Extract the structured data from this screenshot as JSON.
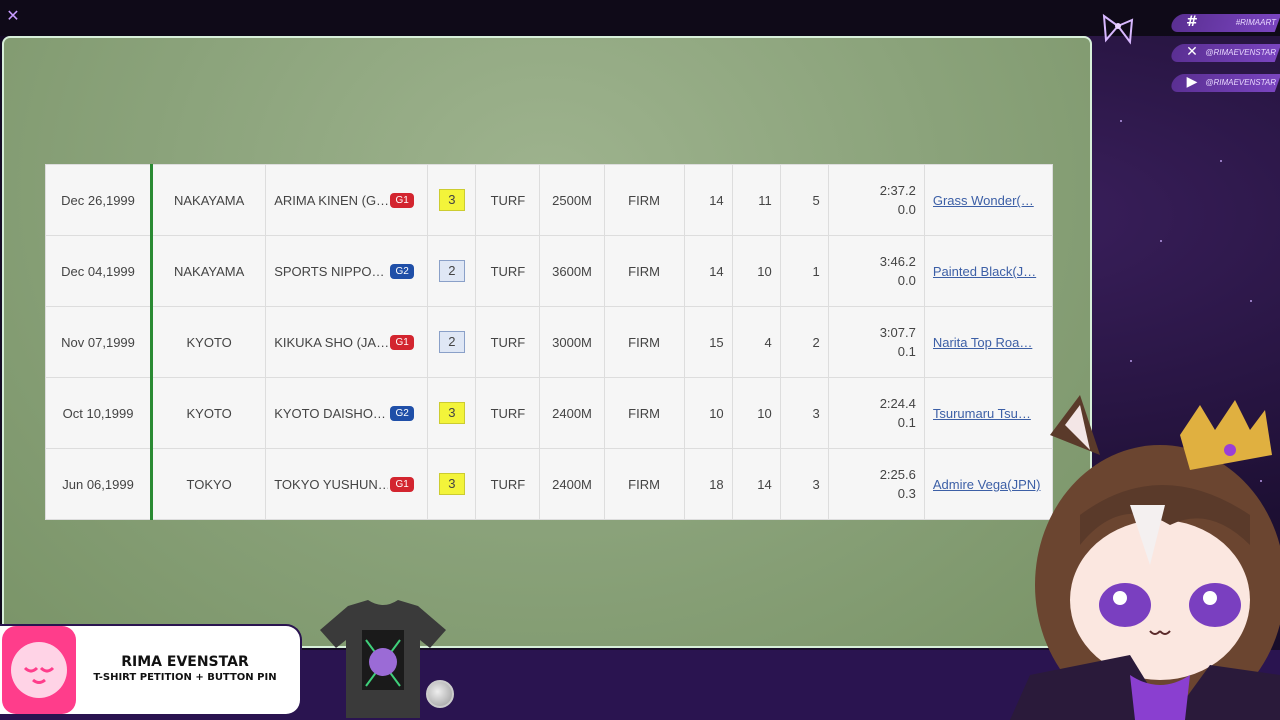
{
  "window": {
    "close_icon": "close-icon"
  },
  "socials": [
    {
      "icon": "hashtag-icon",
      "glyph": "#",
      "handle": "#RIMAART"
    },
    {
      "icon": "x-icon",
      "glyph": "✕",
      "handle": "@RIMAEVENSTAR"
    },
    {
      "icon": "youtube-icon",
      "glyph": "▶",
      "handle": "@RIMAEVENSTAR"
    }
  ],
  "table": {
    "rows": [
      {
        "date": "Dec 26,1999",
        "venue": "NAKAYAMA",
        "race": "ARIMA KINEN (G…",
        "grade": "G1",
        "place": "3",
        "surface": "TURF",
        "distance": "2500M",
        "condition": "FIRM",
        "field": "14",
        "gate": "11",
        "pop": "5",
        "time": "2:37.2",
        "margin": "0.0",
        "winner": "Grass Wonder(…"
      },
      {
        "date": "Dec 04,1999",
        "venue": "NAKAYAMA",
        "race": "SPORTS NIPPO…",
        "grade": "G2",
        "place": "2",
        "surface": "TURF",
        "distance": "3600M",
        "condition": "FIRM",
        "field": "14",
        "gate": "10",
        "pop": "1",
        "time": "3:46.2",
        "margin": "0.0",
        "winner": "Painted Black(J…"
      },
      {
        "date": "Nov 07,1999",
        "venue": "KYOTO",
        "race": "KIKUKA SHO (JA…",
        "grade": "G1",
        "place": "2",
        "surface": "TURF",
        "distance": "3000M",
        "condition": "FIRM",
        "field": "15",
        "gate": "4",
        "pop": "2",
        "time": "3:07.7",
        "margin": "0.1",
        "winner": "Narita Top Roa…"
      },
      {
        "date": "Oct 10,1999",
        "venue": "KYOTO",
        "race": "KYOTO DAISHO…",
        "grade": "G2",
        "place": "3",
        "surface": "TURF",
        "distance": "2400M",
        "condition": "FIRM",
        "field": "10",
        "gate": "10",
        "pop": "3",
        "time": "2:24.4",
        "margin": "0.1",
        "winner": "Tsurumaru Tsu…"
      },
      {
        "date": "Jun 06,1999",
        "venue": "TOKYO",
        "race": "TOKYO YUSHUN…",
        "grade": "G1",
        "place": "3",
        "surface": "TURF",
        "distance": "2400M",
        "condition": "FIRM",
        "field": "18",
        "gate": "14",
        "pop": "3",
        "time": "2:25.6",
        "margin": "0.3",
        "winner": "Admire Vega(JPN)"
      }
    ]
  },
  "overlay": {
    "name": "RIMA EVENSTAR",
    "subtitle": "T-SHIRT PETITION + BUTTON PIN"
  },
  "colors": {
    "accent": "#7a45c0",
    "g1": "#d3252f",
    "g2": "#1f4fa8",
    "place3": "#f3f43a",
    "place2": "#dfe7f5",
    "bubble": "#ff3d8b"
  }
}
